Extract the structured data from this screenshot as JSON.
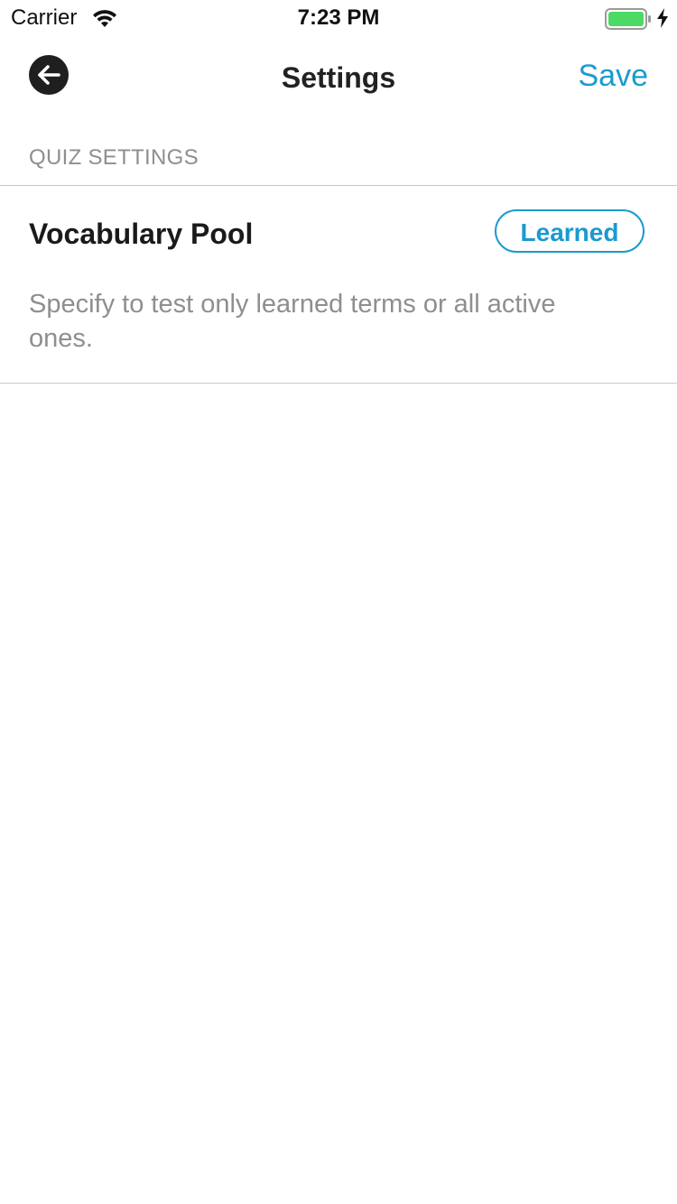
{
  "status_bar": {
    "carrier": "Carrier",
    "time": "7:23 PM",
    "battery_color": "#4cd964",
    "icons": [
      "wifi-icon",
      "battery-icon",
      "charging-bolt-icon"
    ]
  },
  "nav": {
    "title": "Settings",
    "save_label": "Save",
    "back_icon": "arrow-left-icon",
    "accent_color": "#1a9ad0"
  },
  "section": {
    "header": "QUIZ SETTINGS",
    "items": [
      {
        "title": "Vocabulary Pool",
        "value": "Learned",
        "description": "Specify to test only learned terms or all active ones."
      }
    ]
  }
}
